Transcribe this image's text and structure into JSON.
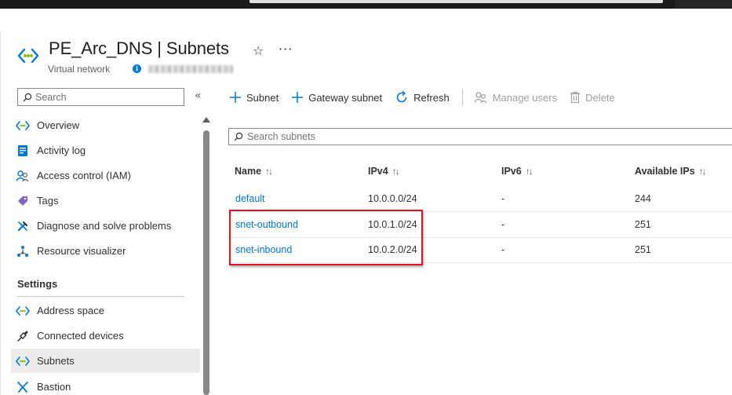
{
  "header": {
    "resource_name": "PE_Arc_DNS",
    "blade_name": "Subnets",
    "resource_type": "Virtual network",
    "star_glyph": "☆",
    "more_glyph": "···"
  },
  "sidebar": {
    "search_placeholder": "Search",
    "collapse_glyph": "«",
    "items": [
      {
        "label": "Overview"
      },
      {
        "label": "Activity log"
      },
      {
        "label": "Access control (IAM)"
      },
      {
        "label": "Tags"
      },
      {
        "label": "Diagnose and solve problems"
      },
      {
        "label": "Resource visualizer"
      }
    ],
    "settings_heading": "Settings",
    "settings_items": [
      {
        "label": "Address space"
      },
      {
        "label": "Connected devices"
      },
      {
        "label": "Subnets",
        "selected": true
      },
      {
        "label": "Bastion"
      }
    ]
  },
  "toolbar": {
    "add_subnet": "Subnet",
    "add_gateway_subnet": "Gateway subnet",
    "refresh": "Refresh",
    "manage_users": "Manage users",
    "delete": "Delete"
  },
  "subnet_search": {
    "placeholder": "Search subnets"
  },
  "table": {
    "columns": [
      "Name",
      "IPv4",
      "IPv6",
      "Available IPs"
    ],
    "sort_glyph": "↑↓",
    "rows": [
      {
        "name": "default",
        "ipv4": "10.0.0.0/24",
        "ipv6": "-",
        "available_ips": "244"
      },
      {
        "name": "snet-outbound",
        "ipv4": "10.0.1.0/24",
        "ipv6": "-",
        "available_ips": "251"
      },
      {
        "name": "snet-inbound",
        "ipv4": "10.0.2.0/24",
        "ipv6": "-",
        "available_ips": "251"
      }
    ]
  },
  "colors": {
    "accent": "#0078d4",
    "highlight_border": "#e81123",
    "selected_nav_bg": "#edebe9"
  },
  "icons": {
    "resource": "vnet-icon",
    "overview": "vnet-icon",
    "activity_log": "activity-log-icon",
    "access_control": "people-icon",
    "tags": "tag-icon",
    "diagnose": "wrench-icon",
    "resource_visualizer": "hierarchy-icon",
    "address_space": "vnet-icon",
    "connected_devices": "plug-icon",
    "subnets": "vnet-icon",
    "bastion": "bastion-icon"
  }
}
